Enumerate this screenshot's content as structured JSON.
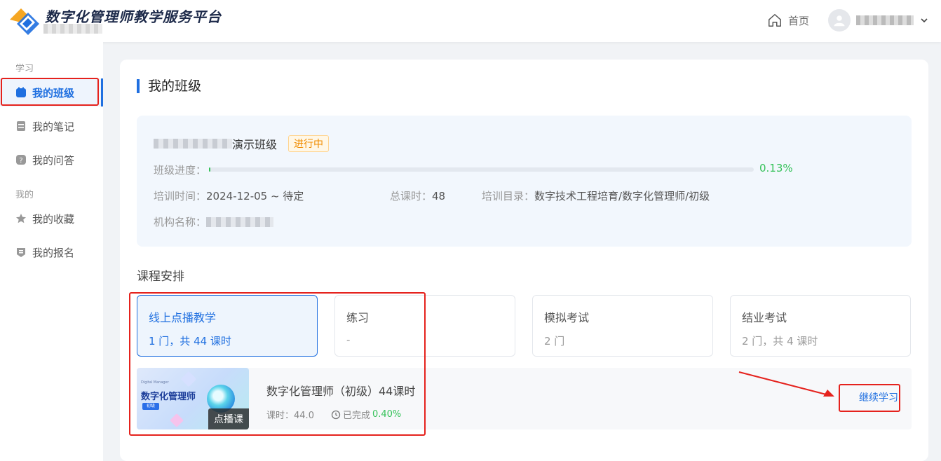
{
  "header": {
    "app_title": "数字化管理师教学服务平台",
    "home_label": "首页",
    "logo_icon": "logo-icon",
    "colors": {
      "brand_orange": "#f5a623",
      "brand_blue": "#1f6fe0"
    }
  },
  "sidebar": {
    "section_learning": "学习",
    "section_mine": "我的",
    "items": [
      {
        "label": "我的班级",
        "icon": "calendar-icon",
        "active": true
      },
      {
        "label": "我的笔记",
        "icon": "note-icon"
      },
      {
        "label": "我的问答",
        "icon": "question-icon"
      },
      {
        "label": "我的收藏",
        "icon": "star-icon"
      },
      {
        "label": "我的报名",
        "icon": "enroll-icon"
      }
    ]
  },
  "main": {
    "title": "我的班级",
    "class": {
      "name_suffix": "演示班级",
      "status": "进行中",
      "progress_label": "班级进度：",
      "progress_value": "0.13%",
      "progress_fraction": 0.0013,
      "train_time_label": "培训时间：",
      "train_time": "2024-12-05 ~ 待定",
      "total_hours_label": "总课时：",
      "total_hours": "48",
      "catalog_label": "培训目录：",
      "catalog": "数字技术工程培育/数字化管理师/初级",
      "org_label": "机构名称："
    },
    "schedule_title": "课程安排",
    "tabs": [
      {
        "name": "线上点播教学",
        "detail": "1 门，共 44 课时",
        "active": true
      },
      {
        "name": "练习",
        "detail": "-"
      },
      {
        "name": "模拟考试",
        "detail": "2 门"
      },
      {
        "name": "结业考试",
        "detail": "2 门，共 4 课时"
      }
    ],
    "course": {
      "title": "数字化管理师（初级）44课时",
      "hours_label": "课时：",
      "hours": "44.0",
      "completed_label": "已完成",
      "completed_pct": "0.40%",
      "thumb_title": "数字化管理师",
      "thumb_sub": "Digital Manager",
      "thumb_level": "初级",
      "thumb_tag": "点播课",
      "action": "继续学习"
    }
  }
}
